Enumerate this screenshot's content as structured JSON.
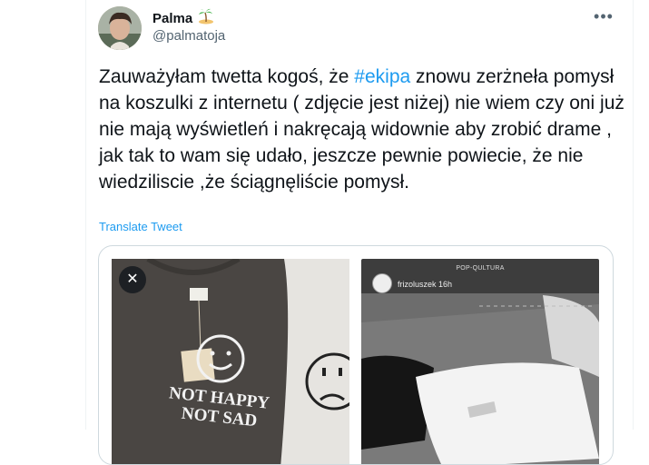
{
  "author": {
    "display_name": "Palma",
    "handle": "@palmatoja",
    "badge_icon": "palm-island-emoji"
  },
  "tweet": {
    "text_before": "Zauważyłam twetta kogoś, że ",
    "hashtag": "#ekipa",
    "text_after": " znowu zerżneła pomysł na koszulki z internetu ( zdjęcie jest niżej) nie wiem czy oni już nie mają wyświetleń i nakręcają widownie aby zrobić drame , jak tak to wam się udało, jeszcze pewnie powiecie, że nie wiedziliscie ,że ściągnęliście pomysł.",
    "translate_label": "Translate Tweet",
    "more_label": "•••"
  },
  "media": {
    "close_label": "✕",
    "photo1": {
      "shirt_text_line1": "NOT HAPPY",
      "shirt_text_line2": "NOT SAD"
    },
    "photo2": {
      "story_header": "POP-QULTURA",
      "story_user": "frizoluszek 16h"
    }
  },
  "colors": {
    "accent": "#1d9bf0",
    "text": "#0f1419",
    "secondary": "#536471",
    "border": "#cfd9de"
  }
}
